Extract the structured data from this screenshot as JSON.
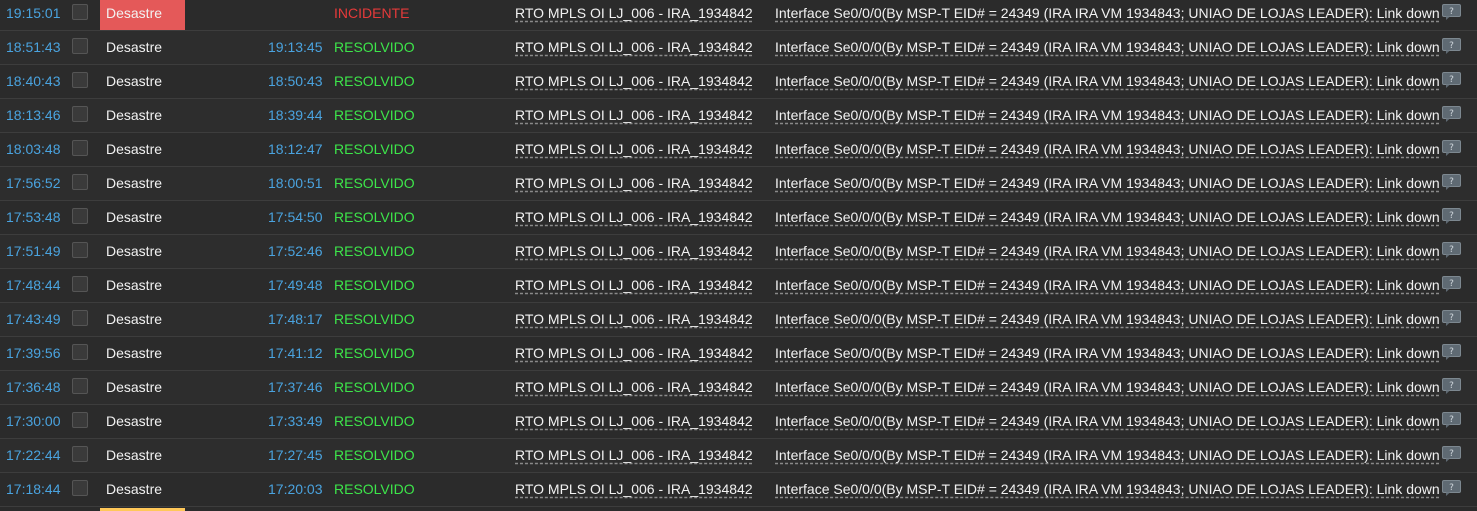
{
  "colors": {
    "background": "#2b2b2b",
    "link_blue": "#4aa3df",
    "resolved_green": "#3de54a",
    "incident_red": "#e53a3a",
    "disaster_bg": "#e45959",
    "average_strip": "#ffc859"
  },
  "icons": {
    "checkbox": "checkbox",
    "comment": "comment-bubble-icon"
  },
  "problems": [
    {
      "start": "19:15:01",
      "severity": "Desastre",
      "end": "",
      "status": "INCIDENTE",
      "host": "RTO MPLS OI LJ_006 - IRA_1934842",
      "problem": "Interface Se0/0/0(By MSP-T EID# = 24349 (IRA IRA VM 1934843; UNIAO DE LOJAS LEADER): Link down"
    },
    {
      "start": "18:51:43",
      "severity": "Desastre",
      "end": "19:13:45",
      "status": "RESOLVIDO",
      "host": "RTO MPLS OI LJ_006 - IRA_1934842",
      "problem": "Interface Se0/0/0(By MSP-T EID# = 24349 (IRA IRA VM 1934843; UNIAO DE LOJAS LEADER): Link down"
    },
    {
      "start": "18:40:43",
      "severity": "Desastre",
      "end": "18:50:43",
      "status": "RESOLVIDO",
      "host": "RTO MPLS OI LJ_006 - IRA_1934842",
      "problem": "Interface Se0/0/0(By MSP-T EID# = 24349 (IRA IRA VM 1934843; UNIAO DE LOJAS LEADER): Link down"
    },
    {
      "start": "18:13:46",
      "severity": "Desastre",
      "end": "18:39:44",
      "status": "RESOLVIDO",
      "host": "RTO MPLS OI LJ_006 - IRA_1934842",
      "problem": "Interface Se0/0/0(By MSP-T EID# = 24349 (IRA IRA VM 1934843; UNIAO DE LOJAS LEADER): Link down"
    },
    {
      "start": "18:03:48",
      "severity": "Desastre",
      "end": "18:12:47",
      "status": "RESOLVIDO",
      "host": "RTO MPLS OI LJ_006 - IRA_1934842",
      "problem": "Interface Se0/0/0(By MSP-T EID# = 24349 (IRA IRA VM 1934843; UNIAO DE LOJAS LEADER): Link down"
    },
    {
      "start": "17:56:52",
      "severity": "Desastre",
      "end": "18:00:51",
      "status": "RESOLVIDO",
      "host": "RTO MPLS OI LJ_006 - IRA_1934842",
      "problem": "Interface Se0/0/0(By MSP-T EID# = 24349 (IRA IRA VM 1934843; UNIAO DE LOJAS LEADER): Link down"
    },
    {
      "start": "17:53:48",
      "severity": "Desastre",
      "end": "17:54:50",
      "status": "RESOLVIDO",
      "host": "RTO MPLS OI LJ_006 - IRA_1934842",
      "problem": "Interface Se0/0/0(By MSP-T EID# = 24349 (IRA IRA VM 1934843; UNIAO DE LOJAS LEADER): Link down"
    },
    {
      "start": "17:51:49",
      "severity": "Desastre",
      "end": "17:52:46",
      "status": "RESOLVIDO",
      "host": "RTO MPLS OI LJ_006 - IRA_1934842",
      "problem": "Interface Se0/0/0(By MSP-T EID# = 24349 (IRA IRA VM 1934843; UNIAO DE LOJAS LEADER): Link down"
    },
    {
      "start": "17:48:44",
      "severity": "Desastre",
      "end": "17:49:48",
      "status": "RESOLVIDO",
      "host": "RTO MPLS OI LJ_006 - IRA_1934842",
      "problem": "Interface Se0/0/0(By MSP-T EID# = 24349 (IRA IRA VM 1934843; UNIAO DE LOJAS LEADER): Link down"
    },
    {
      "start": "17:43:49",
      "severity": "Desastre",
      "end": "17:48:17",
      "status": "RESOLVIDO",
      "host": "RTO MPLS OI LJ_006 - IRA_1934842",
      "problem": "Interface Se0/0/0(By MSP-T EID# = 24349 (IRA IRA VM 1934843; UNIAO DE LOJAS LEADER): Link down"
    },
    {
      "start": "17:39:56",
      "severity": "Desastre",
      "end": "17:41:12",
      "status": "RESOLVIDO",
      "host": "RTO MPLS OI LJ_006 - IRA_1934842",
      "problem": "Interface Se0/0/0(By MSP-T EID# = 24349 (IRA IRA VM 1934843; UNIAO DE LOJAS LEADER): Link down"
    },
    {
      "start": "17:36:48",
      "severity": "Desastre",
      "end": "17:37:46",
      "status": "RESOLVIDO",
      "host": "RTO MPLS OI LJ_006 - IRA_1934842",
      "problem": "Interface Se0/0/0(By MSP-T EID# = 24349 (IRA IRA VM 1934843; UNIAO DE LOJAS LEADER): Link down"
    },
    {
      "start": "17:30:00",
      "severity": "Desastre",
      "end": "17:33:49",
      "status": "RESOLVIDO",
      "host": "RTO MPLS OI LJ_006 - IRA_1934842",
      "problem": "Interface Se0/0/0(By MSP-T EID# = 24349 (IRA IRA VM 1934843; UNIAO DE LOJAS LEADER): Link down"
    },
    {
      "start": "17:22:44",
      "severity": "Desastre",
      "end": "17:27:45",
      "status": "RESOLVIDO",
      "host": "RTO MPLS OI LJ_006 - IRA_1934842",
      "problem": "Interface Se0/0/0(By MSP-T EID# = 24349 (IRA IRA VM 1934843; UNIAO DE LOJAS LEADER): Link down"
    },
    {
      "start": "17:18:44",
      "severity": "Desastre",
      "end": "17:20:03",
      "status": "RESOLVIDO",
      "host": "RTO MPLS OI LJ_006 - IRA_1934842",
      "problem": "Interface Se0/0/0(By MSP-T EID# = 24349 (IRA IRA VM 1934843; UNIAO DE LOJAS LEADER): Link down"
    }
  ]
}
